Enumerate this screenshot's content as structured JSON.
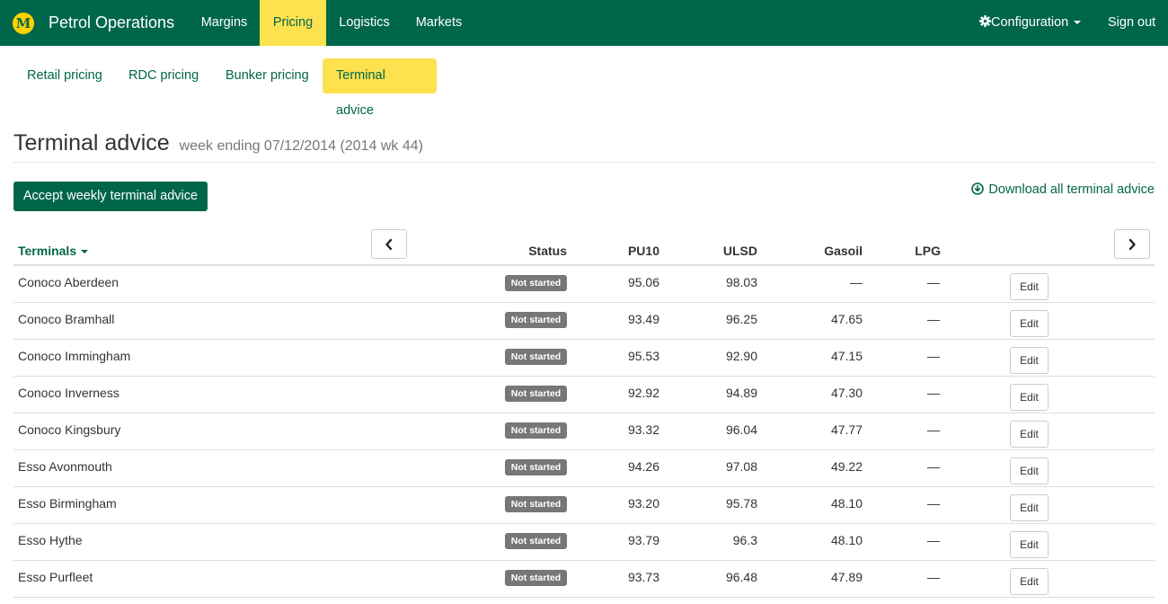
{
  "navbar": {
    "logo_letter": "M",
    "brand": "Petrol Operations",
    "items": [
      {
        "label": "Margins",
        "active": false
      },
      {
        "label": "Pricing",
        "active": true
      },
      {
        "label": "Logistics",
        "active": false
      },
      {
        "label": "Markets",
        "active": false
      }
    ],
    "configuration_label": "Configuration",
    "signout_label": "Sign out"
  },
  "subnav": {
    "items": [
      {
        "label": "Retail pricing",
        "active": false
      },
      {
        "label": "RDC pricing",
        "active": false
      },
      {
        "label": "Bunker pricing",
        "active": false
      },
      {
        "label": "Terminal advice",
        "active": true
      }
    ]
  },
  "page": {
    "title": "Terminal advice",
    "subtitle": "week ending 07/12/2014 (2014 wk 44)",
    "accept_button": "Accept weekly terminal advice",
    "download_link": "Download all terminal advice"
  },
  "table": {
    "headers": {
      "terminals": "Terminals",
      "status": "Status",
      "pu10": "PU10",
      "ulsd": "ULSD",
      "gasoil": "Gasoil",
      "lpg": "LPG"
    },
    "edit_label": "Edit",
    "rows": [
      {
        "terminal": "Conoco Aberdeen",
        "status": "Not started",
        "pu10": "95.06",
        "ulsd": "98.03",
        "gasoil": "—",
        "lpg": "—"
      },
      {
        "terminal": "Conoco Bramhall",
        "status": "Not started",
        "pu10": "93.49",
        "ulsd": "96.25",
        "gasoil": "47.65",
        "lpg": "—"
      },
      {
        "terminal": "Conoco Immingham",
        "status": "Not started",
        "pu10": "95.53",
        "ulsd": "92.90",
        "gasoil": "47.15",
        "lpg": "—"
      },
      {
        "terminal": "Conoco Inverness",
        "status": "Not started",
        "pu10": "92.92",
        "ulsd": "94.89",
        "gasoil": "47.30",
        "lpg": "—"
      },
      {
        "terminal": "Conoco Kingsbury",
        "status": "Not started",
        "pu10": "93.32",
        "ulsd": "96.04",
        "gasoil": "47.77",
        "lpg": "—"
      },
      {
        "terminal": "Esso Avonmouth",
        "status": "Not started",
        "pu10": "94.26",
        "ulsd": "97.08",
        "gasoil": "49.22",
        "lpg": "—"
      },
      {
        "terminal": "Esso Birmingham",
        "status": "Not started",
        "pu10": "93.20",
        "ulsd": "95.78",
        "gasoil": "48.10",
        "lpg": "—"
      },
      {
        "terminal": "Esso Hythe",
        "status": "Not started",
        "pu10": "93.79",
        "ulsd": "96.3",
        "gasoil": "48.10",
        "lpg": "—"
      },
      {
        "terminal": "Esso Purfleet",
        "status": "Not started",
        "pu10": "93.73",
        "ulsd": "96.48",
        "gasoil": "47.89",
        "lpg": "—"
      }
    ]
  },
  "colors": {
    "brand_green": "#00664a",
    "highlight_yellow": "#fee14f",
    "badge_grey": "#777777"
  }
}
